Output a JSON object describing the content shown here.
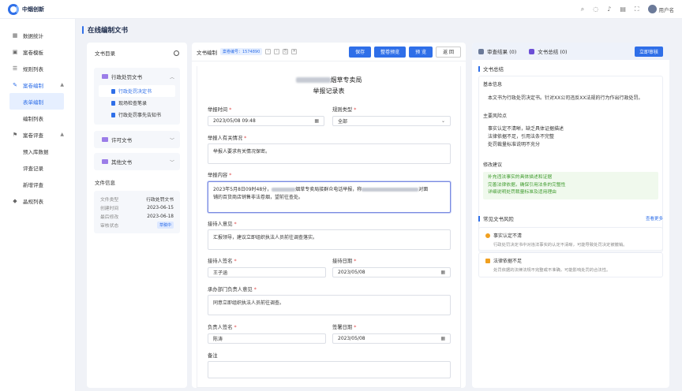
{
  "app": {
    "name": "中烟创新",
    "user": "用户名"
  },
  "topbar": {
    "icons": [
      "search-icon",
      "chat-icon",
      "bell-icon",
      "doc-icon",
      "fullscreen-icon",
      "avatar"
    ]
  },
  "sidebar": {
    "items": [
      {
        "label": "数据统计",
        "icon": "chart-icon"
      },
      {
        "label": "案卷模板",
        "icon": "template-icon"
      },
      {
        "label": "规则列表",
        "icon": "list-icon"
      },
      {
        "label": "案卷编制",
        "icon": "edit-icon",
        "expanded": true,
        "children": [
          {
            "label": "表单编制",
            "active": true
          },
          {
            "label": "编制列表"
          }
        ]
      },
      {
        "label": "案卷评查",
        "icon": "review-icon",
        "expanded": true,
        "children": [
          {
            "label": "预入库数据"
          },
          {
            "label": "评查记录"
          },
          {
            "label": "新增评查"
          }
        ]
      },
      {
        "label": "晶规列表",
        "icon": "diamond-icon"
      }
    ]
  },
  "page": {
    "title": "在线编制文书"
  },
  "left": {
    "title": "文书目录",
    "folders": [
      {
        "label": "行政处罚文书",
        "expanded": true,
        "files": [
          {
            "label": "行政处罚决定书",
            "selected": true
          },
          {
            "label": "现场检查笔录"
          },
          {
            "label": "行政处罚事先告知书"
          }
        ]
      },
      {
        "label": "许可文书",
        "expanded": false
      },
      {
        "label": "其他文书",
        "expanded": false
      }
    ],
    "info_title": "文件信息",
    "info": [
      {
        "k": "文件类型",
        "v": "行政处罚文书"
      },
      {
        "k": "创建时间",
        "v": "2023-06-15"
      },
      {
        "k": "最后修改",
        "v": "2023-06-18"
      },
      {
        "k": "审核状态",
        "v": "草稿中"
      }
    ]
  },
  "editor": {
    "title": "文书编制",
    "code": "案卷编号：1574890",
    "buttons": {
      "save": "保存",
      "preview": "整卷预览",
      "review": "预 览",
      "back": "返 回"
    },
    "doc_title_suffix": "烟草专卖局",
    "doc_title": "举报记录表",
    "fields": {
      "report_time": {
        "label": "举报时间",
        "value": "2023/05/08  09:48"
      },
      "rule_type": {
        "label": "规则类型",
        "value": "全部"
      },
      "reporter_info": {
        "label": "举报人有关情况",
        "value": "举报人要求有关情况保密。"
      },
      "report_content": {
        "label": "举报内容",
        "line1a": "2023年5月8日09时48分，",
        "line1b": "烟草专卖局接群众电话举报，称",
        "line1c": "对面",
        "line2": "铺的百货商店销售非法卷烟，望前往查处。"
      },
      "receiver_opinion": {
        "label": "接待人意见",
        "value": "汇报领导，建议立即组织执法人员前往调查落实。"
      },
      "receiver_sign": {
        "label": "接待人签名",
        "value": "王子涵"
      },
      "receive_date": {
        "label": "接待日期",
        "value": "2023/05/08"
      },
      "dept_opinion": {
        "label": "承办部门负责人意见",
        "value": "同意立即组织执法人员前往调查。"
      },
      "leader_sign": {
        "label": "负责人签名",
        "value": "陈涛"
      },
      "sign_date": {
        "label": "签署日期",
        "value": "2023/05/08"
      },
      "remark": {
        "label": "备注",
        "value": ""
      }
    }
  },
  "right": {
    "tabs": [
      {
        "label": "审查结果  (0)"
      },
      {
        "label": "文书总结  (0)",
        "active": true
      }
    ],
    "submit": "立即审核",
    "summary_title": "文书总结",
    "basic_title": "基本信息",
    "basic_text": "本文书为行政处罚决定书。针对XX公司违反XX法规的行为作出行政处罚。",
    "issues_title": "主要风险点",
    "issues": [
      "事实认定不清晰，缺乏具体证据描述",
      "法律依据不足，引用法条不完整",
      "处罚裁量标准说明不充分"
    ],
    "advice_title": "修改建议",
    "advice": [
      "补充违法事实的具体描述和证据",
      "完善法律依据，确保引用法条的完整性",
      "详细说明处罚裁量标准及适用理由"
    ],
    "risk_title": "常见文书风险",
    "risk_more": "查看更多",
    "risks": [
      {
        "title": "事实认定不清",
        "desc": "行政处罚决定书中对违法事实的认定不清晰，可能导致处罚决定被撤销。"
      },
      {
        "title": "法律依据不足",
        "desc": "处罚依据的法律法规不完整或不准确，可能影响处罚的合法性。"
      }
    ]
  },
  "colors": {
    "primary": "#2f6fe8",
    "focus": "#7a8ae0",
    "success": "#3f9b2e",
    "warning": "#f0a020"
  }
}
